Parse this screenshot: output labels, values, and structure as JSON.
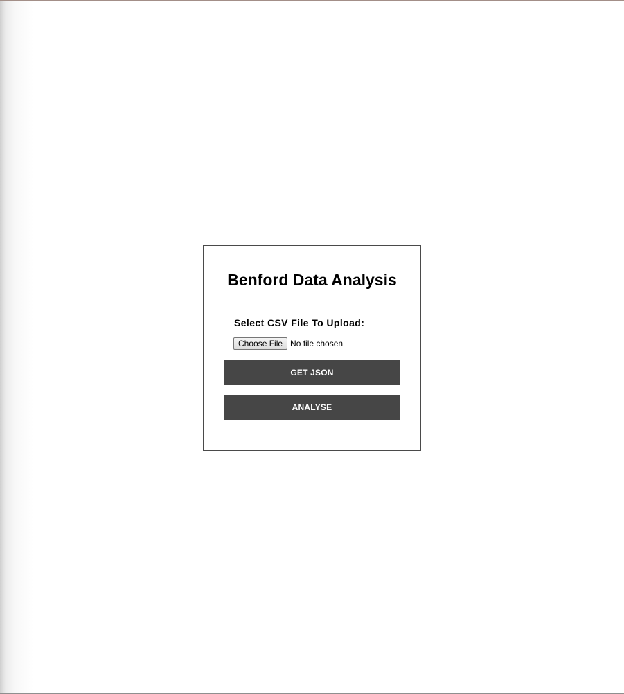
{
  "app": {
    "title": "Benford Data Analysis"
  },
  "upload": {
    "label": "Select CSV File To Upload:",
    "choose_file_label": "Choose File",
    "file_status": "No file chosen"
  },
  "actions": {
    "get_json_label": "GET JSON",
    "analyse_label": "ANALYSE"
  },
  "colors": {
    "button_background": "#464646",
    "button_text": "#ffffff",
    "card_border": "#4a4a4a",
    "page_background": "#ffffff"
  }
}
